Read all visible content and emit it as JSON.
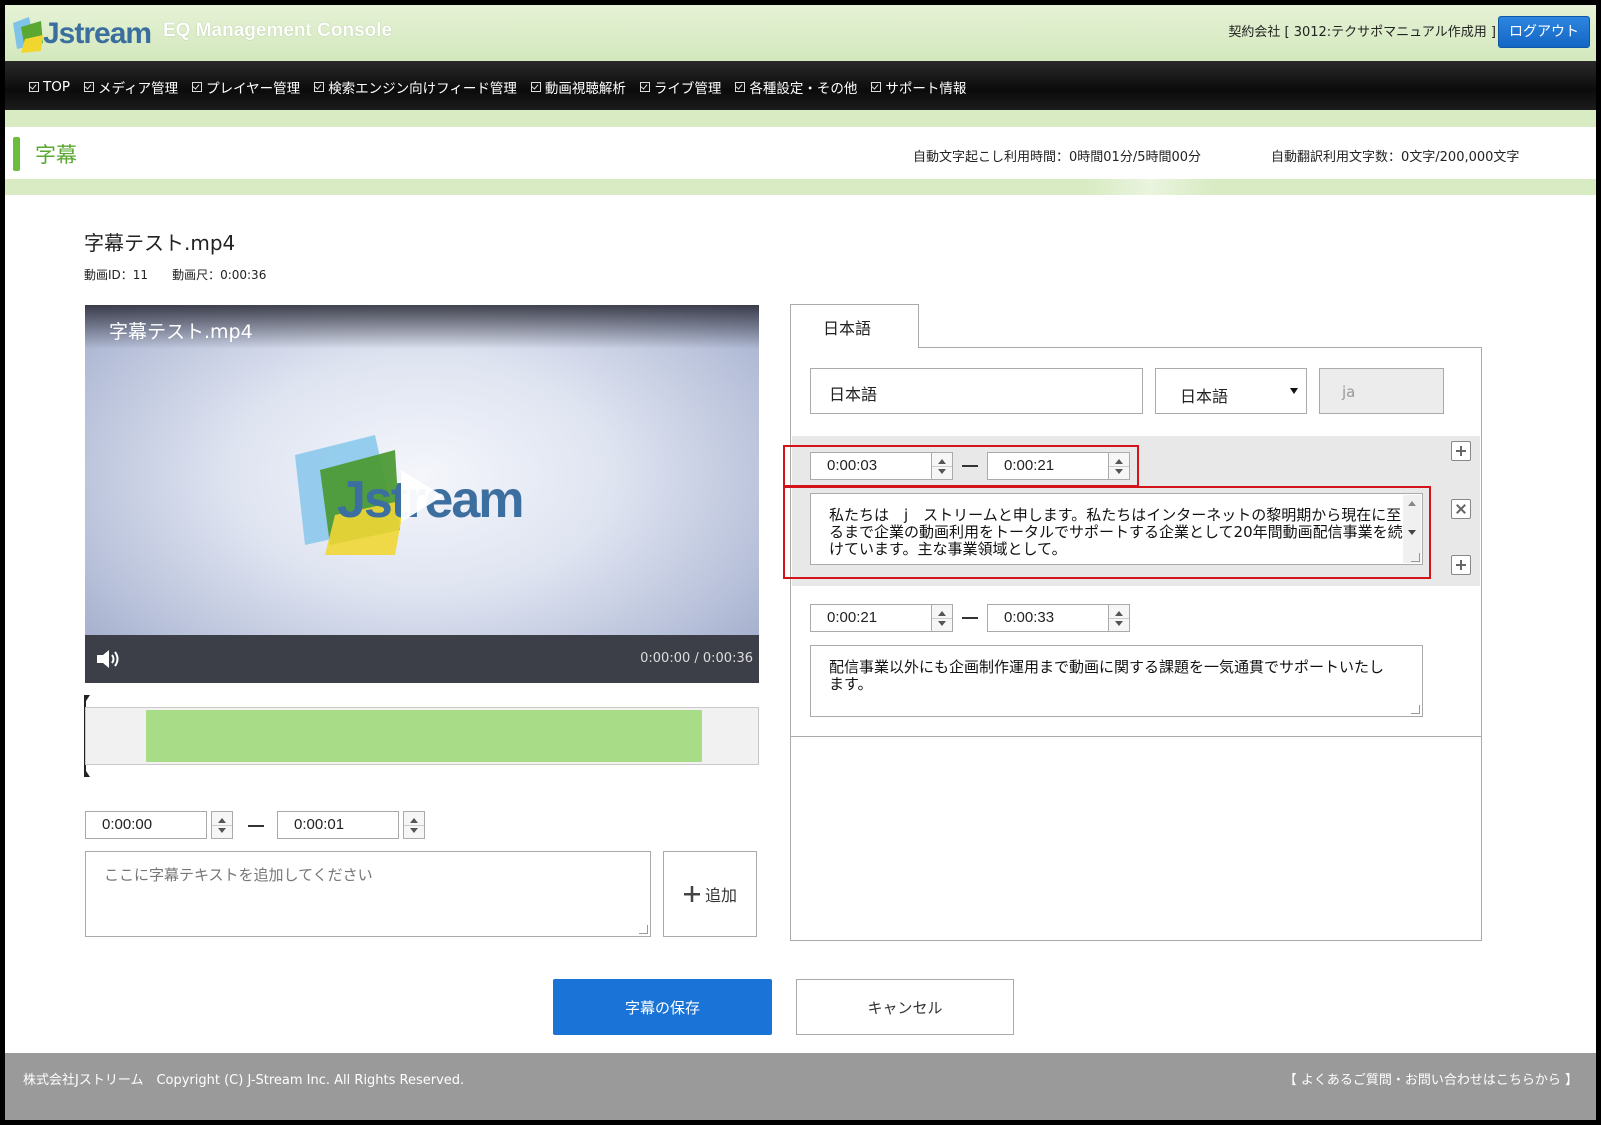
{
  "header": {
    "logo_text": "Jstream",
    "console_title": "EQ Management Console",
    "contract": "契約会社 [ 3012:テクサポマニュアル作成用 ]",
    "logout_label": "ログアウト"
  },
  "nav": {
    "items": [
      "TOP",
      "メディア管理",
      "プレイヤー管理",
      "検索エンジン向けフィード管理",
      "動画視聴解析",
      "ライブ管理",
      "各種設定・その他",
      "サポート情報"
    ]
  },
  "page": {
    "title": "字幕",
    "usage_transcription": "自動文字起こし利用時間：0時間01分/5時間00分",
    "usage_translation": "自動翻訳利用文字数：0文字/200,000文字"
  },
  "file": {
    "name": "字幕テスト.mp4",
    "video_id": "動画ID：11",
    "duration": "動画尺：0:00:36"
  },
  "player": {
    "title": "字幕テスト.mp4",
    "time": "0:00:00 / 0:00:36",
    "progress": 0.0
  },
  "new_caption": {
    "start": "0:00:00",
    "end": "0:00:01",
    "placeholder": "ここに字幕テキストを追加してください",
    "add_label": "追加"
  },
  "editor": {
    "tab_label": "日本語",
    "language_name": "日本語",
    "language_select": "日本語",
    "language_code": "ja",
    "captions": [
      {
        "start": "0:00:03",
        "end": "0:00:21",
        "text": "私たちは　j　ストリームと申します。私たちはインターネットの黎明期から現在に至るまで企業の動画利用をトータルでサポートする企業として20年間動画配信事業を続けています。主な事業領域として。"
      },
      {
        "start": "0:00:21",
        "end": "0:00:33",
        "text": "配信事業以外にも企画制作運用まで動画に関する課題を一気通貫でサポートいたします。"
      }
    ]
  },
  "actions": {
    "save_label": "字幕の保存",
    "cancel_label": "キャンセル"
  },
  "footer": {
    "copyright": "株式会社Jストリーム　Copyright (C) J-Stream Inc. All Rights Reserved.",
    "faq_link": "【 よくあるご質問・お問い合わせはこちらから 】"
  },
  "colors": {
    "accent_green": "#6cbd3e",
    "primary_blue": "#1a73d6",
    "highlight_red": "#d4141b",
    "timeline_green": "#a9dc86"
  }
}
